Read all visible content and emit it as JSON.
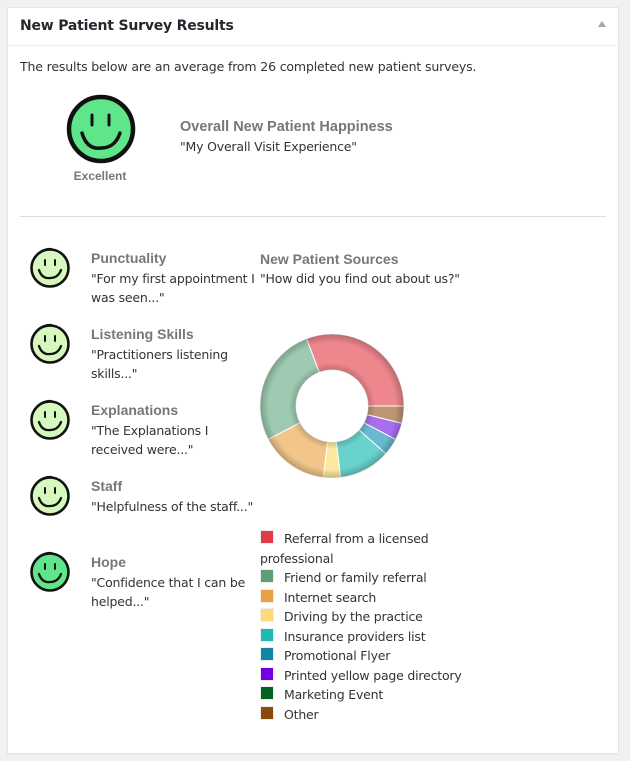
{
  "panel": {
    "title": "New Patient Survey Results",
    "toggle_icon": "triangle-up-icon"
  },
  "intro": "The results below are an average from 26 completed new patient surveys.",
  "overall": {
    "rating": "Excellent",
    "face_color": "#5fe58a",
    "title": "Overall New Patient Happiness",
    "subtitle": "\"My Overall Visit Experience\""
  },
  "items": [
    {
      "title": "Punctuality",
      "subtitle": "\"For my first appointment I was seen...\"",
      "face_color": "#d6f8be"
    },
    {
      "title": "Listening Skills",
      "subtitle": "\"Practitioners listening skills...\"",
      "face_color": "#d6f8be"
    },
    {
      "title": "Explanations",
      "subtitle": "\"The Explanations I received were...\"",
      "face_color": "#d6f8be"
    },
    {
      "title": "Staff",
      "subtitle": "\"Helpfulness of the staff...\"",
      "face_color": "#d6f8be"
    },
    {
      "title": "Hope",
      "subtitle": "\"Confidence that I can be helped...\"",
      "face_color": "#5fe58a"
    }
  ],
  "sources": {
    "title": "New Patient Sources",
    "subtitle": "\"How did you find out about us?\""
  },
  "chart_data": {
    "type": "pie",
    "variant": "doughnut",
    "title": "New Patient Sources",
    "categories": [
      "Referral from a licensed professional",
      "Friend or family referral",
      "Internet search",
      "Driving by the practice",
      "Insurance providers list",
      "Promotional Flyer",
      "Printed yellow page directory",
      "Marketing Event",
      "Other"
    ],
    "values": [
      8,
      7,
      4,
      1,
      3,
      1,
      1,
      0,
      1
    ],
    "colors": [
      "#e23a48",
      "#5c9e74",
      "#eaa041",
      "#ffd976",
      "#1dbab2",
      "#1385a7",
      "#7300e0",
      "#046322",
      "#8a4a0c"
    ],
    "slice_colors": [
      "#ee868d",
      "#9dcab0",
      "#f1c688",
      "#fce9a0",
      "#68d2cc",
      "#6ab8d2",
      "#a86ef0",
      "#5aa070",
      "#bd9572"
    ],
    "legend_position": "bottom"
  }
}
